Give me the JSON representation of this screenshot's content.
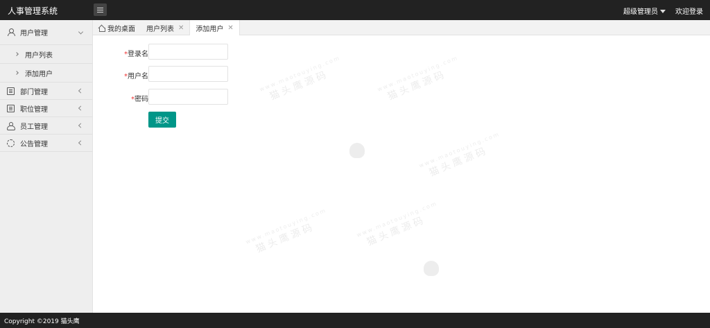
{
  "header": {
    "app_title": "人事管理系统",
    "admin_label": "超级管理员",
    "logout_label": "欢迎登录"
  },
  "sidebar": {
    "items": [
      {
        "label": "用户管理",
        "icon": "user-icon",
        "expanded": true,
        "children": [
          {
            "label": "用户列表"
          },
          {
            "label": "添加用户"
          }
        ]
      },
      {
        "label": "部门管理",
        "icon": "document-icon"
      },
      {
        "label": "职位管理",
        "icon": "document-icon"
      },
      {
        "label": "员工管理",
        "icon": "group-icon"
      },
      {
        "label": "公告管理",
        "icon": "cycle-icon"
      }
    ]
  },
  "tabs": [
    {
      "label": "我的桌面",
      "icon": "home-icon"
    },
    {
      "label": "用户列表",
      "closable": true
    },
    {
      "label": "添加用户",
      "closable": true,
      "active": true
    }
  ],
  "form": {
    "required_mark": "*",
    "fields": [
      {
        "label": "登录名",
        "value": ""
      },
      {
        "label": "用户名",
        "value": ""
      },
      {
        "label": "密码",
        "value": ""
      }
    ],
    "submit_label": "提交"
  },
  "watermark": {
    "url": "www.maotouying.com",
    "text": "猫头鹰源码"
  },
  "footer": {
    "copyright": "Copyright ©2019 猫头鹰"
  },
  "colors": {
    "topbar": "#222222",
    "primary_button": "#009688",
    "required": "#ee3333",
    "sidebar_bg": "#eeeeee"
  }
}
